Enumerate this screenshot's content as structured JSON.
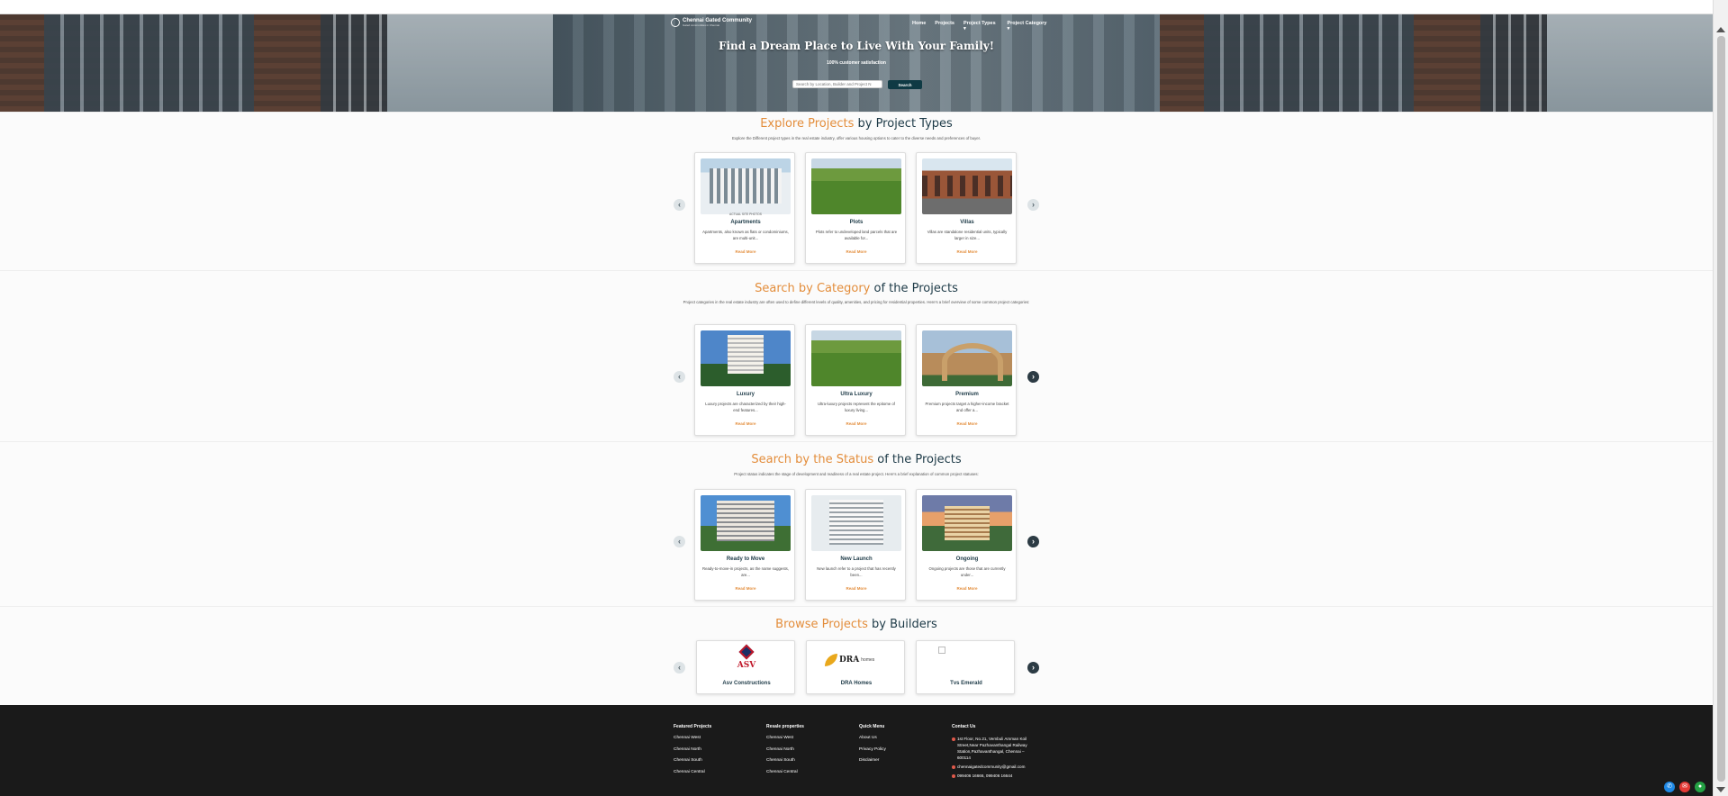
{
  "nav": {
    "logo_name": "Chennai Gated Community",
    "logo_tagline": "Gated communities in Chennai",
    "items": [
      "Home",
      "Projects",
      "Project Types ▾",
      "Project Category ▾"
    ]
  },
  "hero": {
    "title": "Find a Dream Place to Live With Your Family!",
    "subtitle": "100% customer satisfaction",
    "search_placeholder": "Search by Location, Builder and Project N",
    "search_button": "Search"
  },
  "types": {
    "title_hl": "Explore Projects",
    "title_rest": " by Project Types",
    "desc": "Explore the Different project types in the real estate industry, offer various housing options to cater to the diverse needs and preferences of buyer.",
    "cards": [
      {
        "name": "Apartments",
        "text": "Apartments, also known as flats or condominiums, are multi-unit...",
        "more": "Read More",
        "tag": "ACTUAL SITE PHOTOS"
      },
      {
        "name": "Plots",
        "text": "Plots refer to undeveloped land parcels that are available for...",
        "more": "Read More"
      },
      {
        "name": "Villas",
        "text": "Villas are standalone residential units, typically larger in size...",
        "more": "Read More"
      }
    ]
  },
  "category": {
    "title_hl": "Search by Category",
    "title_rest": " of the Projects",
    "desc": "Project categories in the real estate industry are often used to define different levels of quality, amenities, and pricing for residential properties. Here's a brief overview of some common project categories:",
    "cards": [
      {
        "name": "Luxury",
        "text": "Luxury projects are characterized by their high-end features...",
        "more": "Read More"
      },
      {
        "name": "Ultra Luxury",
        "text": "Ultra-luxury projects represent the epitome of luxury living...",
        "more": "Read More"
      },
      {
        "name": "Premium",
        "text": "Premium projects target a higher-income bracket and offer a...",
        "more": "Read More"
      }
    ]
  },
  "status": {
    "title_hl": "Search by the Status",
    "title_rest": " of the Projects",
    "desc": "Project status indicates the stage of development and readiness of a real estate project. Here's a brief explanation of common project statuses:",
    "cards": [
      {
        "name": "Ready to Move",
        "text": "Ready-to-move-in projects, as the name suggests, are...",
        "more": "Read More"
      },
      {
        "name": "New Launch",
        "text": "New launch refer to a project that has recently been...",
        "more": "Read More"
      },
      {
        "name": "Ongoing",
        "text": "Ongoing projects are those that are currently under...",
        "more": "Read More"
      }
    ]
  },
  "builders": {
    "title_hl": "Browse Projects",
    "title_rest": " by Builders",
    "cards": [
      {
        "name": "Asv Constructions",
        "logo_text": "ASV"
      },
      {
        "name": "DRA Homes",
        "logo_text": "DRA",
        "logo_sub": "homes"
      },
      {
        "name": "Tvs Emerald"
      }
    ]
  },
  "footer": {
    "featured": {
      "title": "Featured Projects",
      "items": [
        "Chennai West",
        "Chennai North",
        "Chennai South",
        "Chennai Central"
      ]
    },
    "resale": {
      "title": "Resale properties",
      "items": [
        "Chennai West",
        "Chennai North",
        "Chennai South",
        "Chennai Central"
      ]
    },
    "quick": {
      "title": "Quick Menu",
      "items": [
        "About Us",
        "Privacy Policy",
        "Disclaimer"
      ]
    },
    "contact": {
      "title": "Contact Us",
      "address": "1st Floor, No.21, Vembuli Amman Koil Street,Near Pazhavanthangal Railway Station,Pazhavanthangal, Chennai – 600114",
      "email": "chennaigatedcommunity@gmail.com",
      "phone": "099406 16666, 099406 16644"
    }
  },
  "colors": {
    "accent": "#e38d3b",
    "heading": "#1d3a47",
    "footer_bg": "#1a1a1a",
    "button": "#0f3a44"
  }
}
